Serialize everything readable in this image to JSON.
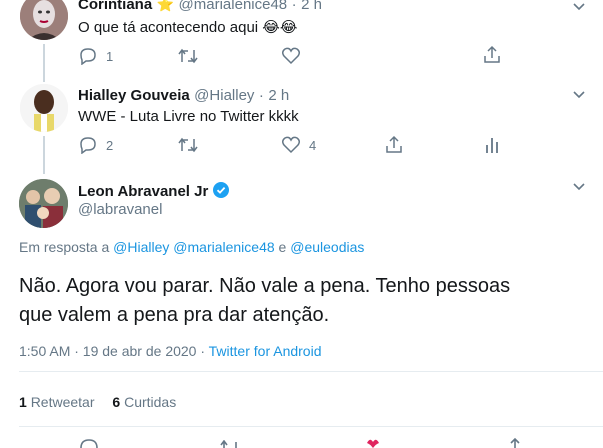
{
  "tweets": [
    {
      "name": "Corintiana",
      "handle": "@marialenice48",
      "time": "2 h",
      "text": "O que tá acontecendo aqui 😂😂",
      "replies": "1",
      "retweets": "",
      "likes": ""
    },
    {
      "name": "Hialley Gouveia",
      "handle": "@Hialley",
      "time": "2 h",
      "text": "WWE - Luta Livre no Twitter kkkk",
      "replies": "2",
      "retweets": "",
      "likes": "4"
    }
  ],
  "main": {
    "name": "Leon Abravanel Jr",
    "handle": "@labravanel",
    "reply_prefix": "Em resposta a",
    "mentions": [
      "@Hialley",
      "@marialenice48",
      "e",
      "@euleodias"
    ],
    "text_line1": "Não. Agora vou parar. Não vale a pena. Tenho pessoas",
    "text_line2": "que valem a pena pra dar atenção.",
    "timestamp": "1:50 AM · 19 de abr de 2020 ·",
    "source": "Twitter for Android",
    "retweet_count": "1",
    "retweet_label": "Retweetar",
    "like_count": "6",
    "like_label": "Curtidas"
  },
  "meta": {
    "separator": "·",
    "star_emoji": "⭐"
  },
  "colors": {
    "link": "#1b95e0",
    "secondary": "#657786",
    "verified": "#1da1f2"
  }
}
